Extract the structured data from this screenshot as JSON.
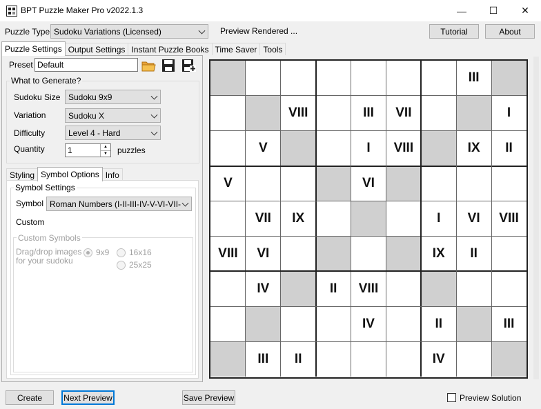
{
  "window": {
    "title": "BPT Puzzle Maker Pro v2022.1.3",
    "min": "—",
    "max": "☐",
    "close": "✕"
  },
  "toolbar": {
    "puzzle_type_label": "Puzzle Type",
    "puzzle_type_value": "Sudoku Variations (Licensed)",
    "status": "Preview Rendered ...",
    "tutorial": "Tutorial",
    "about": "About"
  },
  "tabs": [
    "Puzzle Settings",
    "Output Settings",
    "Instant Puzzle Books",
    "Time Saver",
    "Tools"
  ],
  "preset": {
    "label": "Preset",
    "value": "Default"
  },
  "generate": {
    "title": "What to Generate?",
    "size_label": "Sudoku Size",
    "size_value": "Sudoku  9x9",
    "variation_label": "Variation",
    "variation_value": "Sudoku X",
    "difficulty_label": "Difficulty",
    "difficulty_value": "Level 4 - Hard",
    "quantity_label": "Quantity",
    "quantity_value": "1",
    "quantity_unit": "puzzles"
  },
  "subtabs": [
    "Styling",
    "Symbol Options",
    "Info"
  ],
  "symbols": {
    "title": "Symbol Settings",
    "symbol_label": "Symbol",
    "symbol_value": "Roman Numbers (I-II-III-IV-V-VI-VII-VIII-I...",
    "custom_label": "Custom",
    "custom_group": "Custom Symbols",
    "drag_line1": "Drag/drop images",
    "drag_line2": "for your sudoku",
    "opt_9": "9x9",
    "opt_16": "16x16",
    "opt_25": "25x25"
  },
  "bottom": {
    "create": "Create",
    "next_preview": "Next Preview",
    "save_preview": "Save Preview",
    "preview_solution": "Preview Solution"
  },
  "grid": {
    "cells": [
      [
        "",
        "",
        "",
        "",
        "",
        "",
        "",
        "III",
        ""
      ],
      [
        "",
        "",
        "VIII",
        "",
        "III",
        "VII",
        "",
        "",
        "I"
      ],
      [
        "",
        "V",
        "",
        "",
        "I",
        "VIII",
        "",
        "IX",
        "II"
      ],
      [
        "V",
        "",
        "",
        "",
        "VI",
        "",
        "",
        "",
        ""
      ],
      [
        "",
        "VII",
        "IX",
        "",
        "",
        "",
        "I",
        "VI",
        "VIII"
      ],
      [
        "VIII",
        "VI",
        "",
        "",
        "",
        "",
        "IX",
        "II",
        ""
      ],
      [
        "",
        "IV",
        "",
        "II",
        "VIII",
        "",
        "",
        "",
        ""
      ],
      [
        "",
        "",
        "",
        "",
        "IV",
        "",
        "II",
        "",
        "III"
      ],
      [
        "",
        "III",
        "II",
        "",
        "",
        "",
        "IV",
        "",
        ""
      ]
    ],
    "shade_color": "#d0d0d0"
  }
}
